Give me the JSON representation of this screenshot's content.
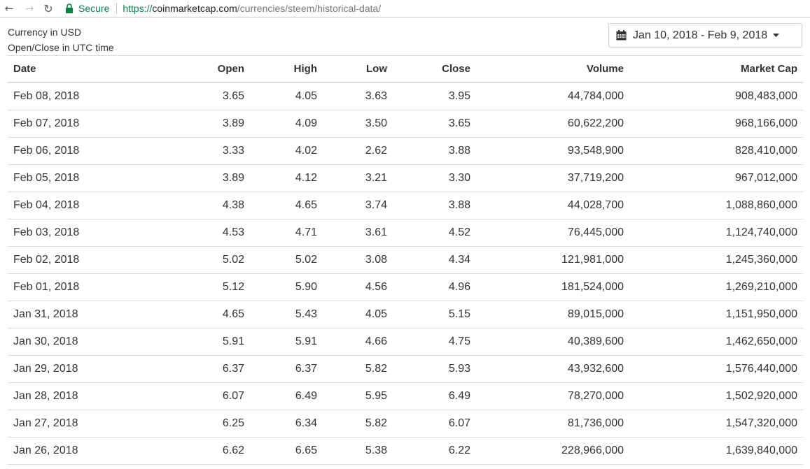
{
  "browser": {
    "secure_label": "Secure",
    "url_scheme": "https://",
    "url_host": "coinmarketcap.com",
    "url_path": "/currencies/steem/historical-data/"
  },
  "info": {
    "currency": "Currency in USD",
    "time_note": "Open/Close in UTC time"
  },
  "date_range": {
    "label": "Jan 10, 2018 - Feb 9, 2018"
  },
  "table": {
    "headers": [
      "Date",
      "Open",
      "High",
      "Low",
      "Close",
      "Volume",
      "Market Cap"
    ],
    "rows": [
      [
        "Feb 08, 2018",
        "3.65",
        "4.05",
        "3.63",
        "3.95",
        "44,784,000",
        "908,483,000"
      ],
      [
        "Feb 07, 2018",
        "3.89",
        "4.09",
        "3.50",
        "3.65",
        "60,622,200",
        "968,166,000"
      ],
      [
        "Feb 06, 2018",
        "3.33",
        "4.02",
        "2.62",
        "3.88",
        "93,548,900",
        "828,410,000"
      ],
      [
        "Feb 05, 2018",
        "3.89",
        "4.12",
        "3.21",
        "3.30",
        "37,719,200",
        "967,012,000"
      ],
      [
        "Feb 04, 2018",
        "4.38",
        "4.65",
        "3.74",
        "3.88",
        "44,028,700",
        "1,088,860,000"
      ],
      [
        "Feb 03, 2018",
        "4.53",
        "4.71",
        "3.61",
        "4.52",
        "76,445,000",
        "1,124,740,000"
      ],
      [
        "Feb 02, 2018",
        "5.02",
        "5.02",
        "3.08",
        "4.34",
        "121,981,000",
        "1,245,360,000"
      ],
      [
        "Feb 01, 2018",
        "5.12",
        "5.90",
        "4.56",
        "4.96",
        "181,524,000",
        "1,269,210,000"
      ],
      [
        "Jan 31, 2018",
        "4.65",
        "5.43",
        "4.05",
        "5.15",
        "89,015,000",
        "1,151,950,000"
      ],
      [
        "Jan 30, 2018",
        "5.91",
        "5.91",
        "4.66",
        "4.75",
        "40,389,600",
        "1,462,650,000"
      ],
      [
        "Jan 29, 2018",
        "6.37",
        "6.37",
        "5.82",
        "5.93",
        "43,932,600",
        "1,576,440,000"
      ],
      [
        "Jan 28, 2018",
        "6.07",
        "6.49",
        "5.95",
        "6.49",
        "78,270,000",
        "1,502,920,000"
      ],
      [
        "Jan 27, 2018",
        "6.25",
        "6.34",
        "5.82",
        "6.07",
        "81,736,000",
        "1,547,320,000"
      ],
      [
        "Jan 26, 2018",
        "6.62",
        "6.65",
        "5.38",
        "6.22",
        "228,966,000",
        "1,639,840,000"
      ]
    ]
  },
  "icons": {
    "back": "arrow-left-icon",
    "forward": "arrow-right-icon",
    "reload": "reload-icon",
    "lock": "lock-icon",
    "calendar": "calendar-icon",
    "caret": "caret-down-icon"
  },
  "colors": {
    "secure_green": "#0b8043",
    "text": "#333333",
    "border": "#dddddd"
  }
}
